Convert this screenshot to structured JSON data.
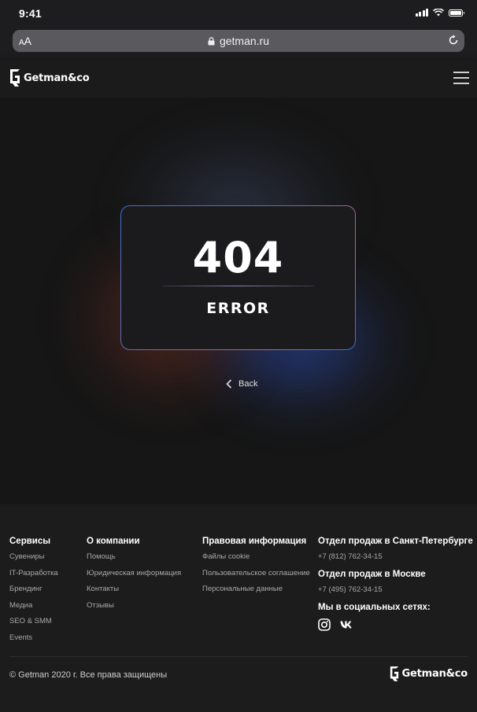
{
  "status_bar": {
    "time": "9:41"
  },
  "browser": {
    "aa_label_small": "A",
    "aa_label_large": "A",
    "url": "getman.ru"
  },
  "header": {
    "logo_text": "Getman&co"
  },
  "main": {
    "error_code": "404",
    "error_label": "ERROR",
    "back_label": "Back"
  },
  "footer": {
    "columns": [
      {
        "title": "Сервисы",
        "items": [
          "Сувениры",
          "IT-Разработка",
          "Брендинг",
          "Медиа",
          "SEO & SMM",
          "Events"
        ]
      },
      {
        "title": "О компании",
        "items": [
          "Помощь",
          "Юридическая информация",
          "Контакты",
          "Отзывы"
        ]
      },
      {
        "title": "Правовая информация",
        "items": [
          "Файлы cookie",
          "Пользовательское соглашение",
          "Персональные данные"
        ]
      }
    ],
    "contacts": {
      "spb_title": "Отдел продаж в Санкт-Петербурге",
      "spb_phone": "+7 (812) 762-34-15",
      "msk_title": "Отдел продаж в Москве",
      "msk_phone": "+7 (495) 762-34-15",
      "social_title": "Мы в социальных сетях:",
      "social_icons": [
        "instagram-icon",
        "vk-icon"
      ]
    },
    "copyright": "© Getman 2020 г. Все права защищены",
    "logo_text": "Getman&co"
  },
  "colors": {
    "background": "#151515",
    "footer": "#1c1c1c",
    "accent_blue": "#3a6fd8",
    "accent_red": "#b06a70"
  }
}
